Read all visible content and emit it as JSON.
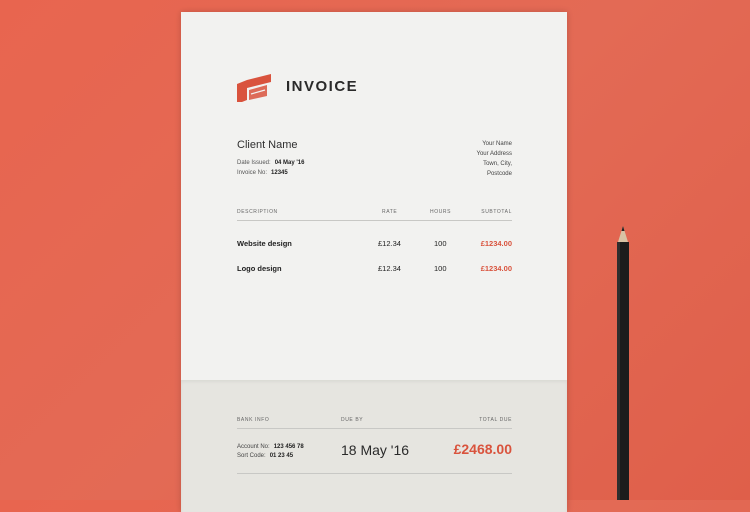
{
  "document": {
    "title": "INVOICE",
    "client": {
      "name": "Client Name",
      "date_label": "Date Issued:",
      "date_value": "04 May '16",
      "invoice_label": "Invoice No:",
      "invoice_value": "12345"
    },
    "sender_address": [
      "Your Name",
      "Your Address",
      "Town, City,",
      "Postcode"
    ],
    "table": {
      "headers": [
        "DESCRIPTION",
        "RATE",
        "HOURS",
        "SUBTOTAL"
      ],
      "rows": [
        {
          "description": "Website design",
          "rate": "£12.34",
          "hours": "100",
          "subtotal": "£1234.00"
        },
        {
          "description": "Logo design",
          "rate": "£12.34",
          "hours": "100",
          "subtotal": "£1234.00"
        }
      ]
    },
    "footer": {
      "bank_header": "BANK INFO",
      "due_header": "DUE BY",
      "total_header": "TOTAL DUE",
      "account_label": "Account No:",
      "account_value": "123 456 78",
      "sort_label": "Sort Code:",
      "sort_value": "01 23 45",
      "due_date": "18 May '16",
      "total_due": "£2468.00"
    }
  },
  "colors": {
    "background": "#e3654f",
    "accent": "#d9533d",
    "paper": "#f2f2f0",
    "paper_fold": "#e6e5e0"
  },
  "icons": {
    "logo": "brand-logo-icon",
    "pencil": "pencil-icon"
  }
}
